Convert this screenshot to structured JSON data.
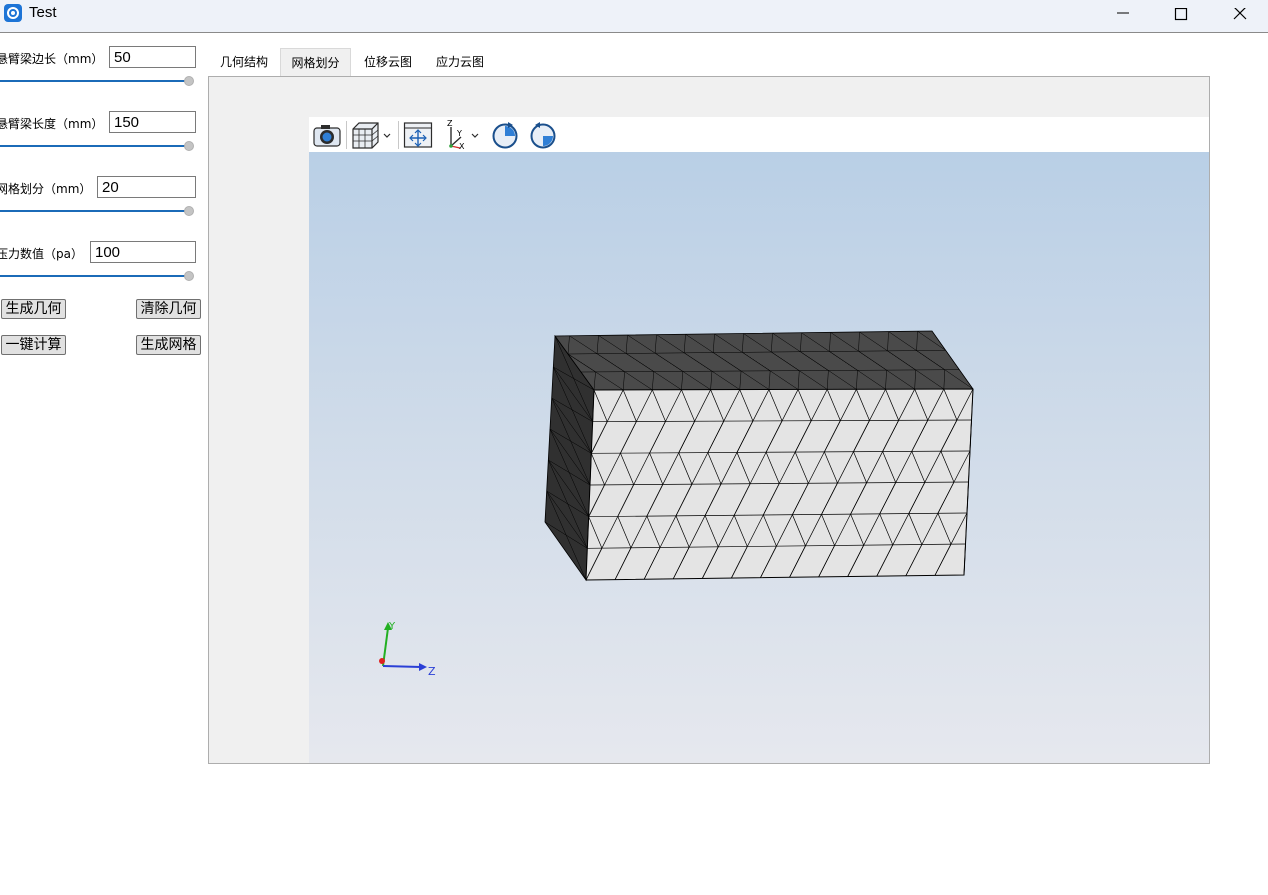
{
  "window": {
    "title": "Test"
  },
  "params": [
    {
      "label": "悬臂梁边长（mm）",
      "value": "50"
    },
    {
      "label": "悬臂梁长度（mm）",
      "value": "150"
    },
    {
      "label": "网格划分（mm）",
      "value": "20"
    },
    {
      "label": "压力数值（pa）",
      "value": "100"
    }
  ],
  "buttons": {
    "generate_geometry": "生成几何",
    "clear_geometry": "清除几何",
    "one_click_compute": "一键计算",
    "generate_mesh": "生成网格"
  },
  "tabs": [
    {
      "label": "几何结构",
      "active": false
    },
    {
      "label": "网格划分",
      "active": true
    },
    {
      "label": "位移云图",
      "active": false
    },
    {
      "label": "应力云图",
      "active": false
    }
  ],
  "viewer": {
    "toolbar_icons": [
      "camera-icon",
      "view-cube-icon",
      "fit-all-icon",
      "axis-triad-icon",
      "rotate-cw-icon",
      "rotate-ccw-icon"
    ],
    "triad": {
      "y_label": "Y",
      "z_label": "Z"
    },
    "mesh_colors": {
      "top_face": "#4a4a4a",
      "side_face": "#303030",
      "front_face": "#e4e4e4",
      "edges": "#000000"
    }
  },
  "colors": {
    "accent": "#1b6bb8",
    "titlebar": "#eef2f9",
    "panel": "#f0f0f0"
  }
}
